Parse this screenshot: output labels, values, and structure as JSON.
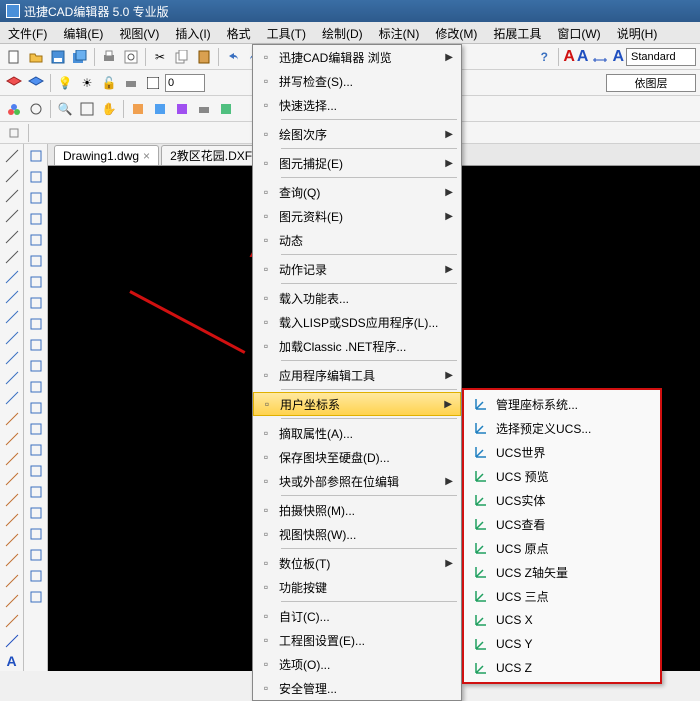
{
  "title": "迅捷CAD编辑器 5.0 专业版",
  "menubar": [
    "文件(F)",
    "编辑(E)",
    "视图(V)",
    "插入(I)",
    "格式",
    "工具(T)",
    "绘制(D)",
    "标注(N)",
    "修改(M)",
    "拓展工具",
    "窗口(W)",
    "说明(H)"
  ],
  "toolbar2_input": "0",
  "style_box": "Standard",
  "layer_box": "依图层",
  "tabs": [
    {
      "label": "Drawing1.dwg",
      "active": true
    },
    {
      "label": "2教区花园.DXF",
      "active": false
    }
  ],
  "dropdown": [
    {
      "t": "迅捷CAD编辑器 浏览",
      "arr": true
    },
    {
      "t": "拼写检查(S)..."
    },
    {
      "t": "快速选择..."
    },
    {
      "sep": true
    },
    {
      "t": "绘图次序",
      "arr": true
    },
    {
      "sep": true
    },
    {
      "t": "图元捕捉(E)",
      "arr": true
    },
    {
      "sep": true
    },
    {
      "t": "查询(Q)",
      "arr": true
    },
    {
      "t": "图元资料(E)",
      "arr": true
    },
    {
      "t": "动态"
    },
    {
      "sep": true
    },
    {
      "t": "动作记录",
      "arr": true
    },
    {
      "sep": true
    },
    {
      "t": "载入功能表..."
    },
    {
      "t": "载入LISP或SDS应用程序(L)..."
    },
    {
      "t": "加载Classic .NET程序..."
    },
    {
      "sep": true
    },
    {
      "t": "应用程序编辑工具",
      "arr": true
    },
    {
      "sep": true
    },
    {
      "t": "用户坐标系",
      "arr": true,
      "hl": true
    },
    {
      "sep": true
    },
    {
      "t": "摘取属性(A)..."
    },
    {
      "t": "保存图块至硬盘(D)..."
    },
    {
      "t": "块或外部参照在位编辑",
      "arr": true
    },
    {
      "sep": true
    },
    {
      "t": "拍摄快照(M)..."
    },
    {
      "t": "视图快照(W)..."
    },
    {
      "sep": true
    },
    {
      "t": "数位板(T)",
      "arr": true
    },
    {
      "t": "功能按键"
    },
    {
      "sep": true
    },
    {
      "t": "自订(C)..."
    },
    {
      "t": "工程图设置(E)..."
    },
    {
      "t": "选项(O)..."
    },
    {
      "t": "安全管理..."
    }
  ],
  "submenu": [
    "管理座标系统...",
    "选择预定义UCS...",
    "UCS世界",
    "UCS 预览",
    "UCS实体",
    "UCS查看",
    "UCS 原点",
    "UCS Z轴矢量",
    "UCS 三点",
    "UCS X",
    "UCS Y",
    "UCS Z"
  ]
}
